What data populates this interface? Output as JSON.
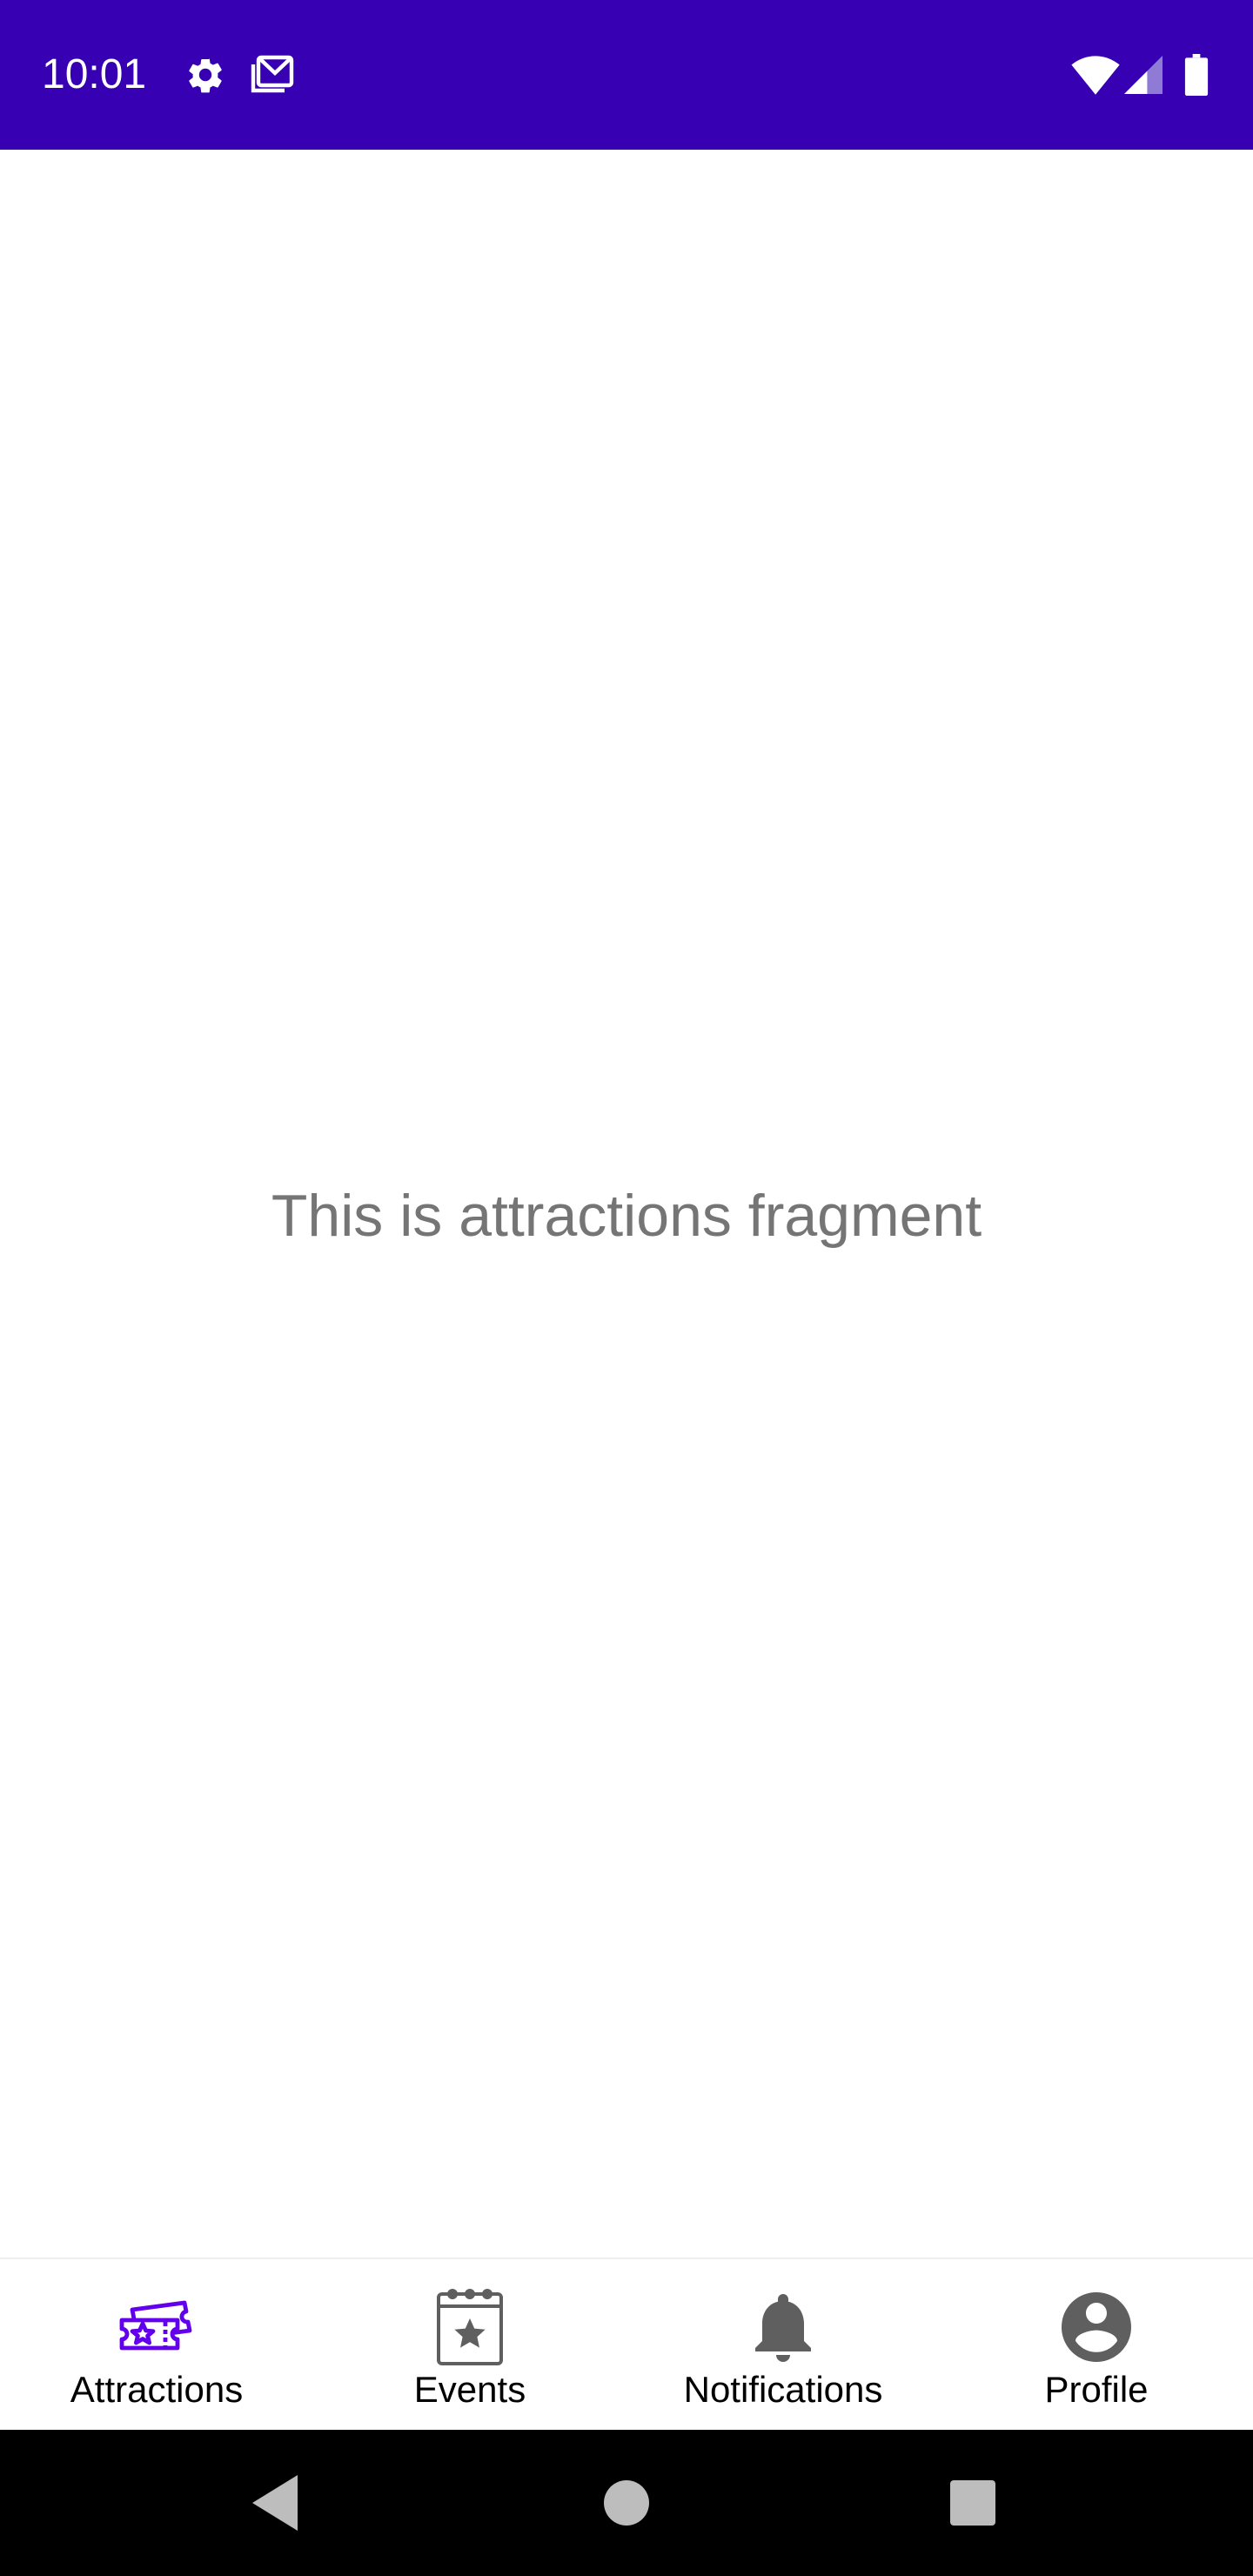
{
  "status_bar": {
    "time": "10:01",
    "background": "#3700b3",
    "icons": [
      "gear-icon",
      "gmail-icon",
      "wifi-icon",
      "cell-signal-icon",
      "battery-icon"
    ]
  },
  "content": {
    "message": "This is attractions fragment",
    "text_color": "#757575"
  },
  "bottom_nav": {
    "active_color": "#6200ee",
    "inactive_icon_color": "#5f5f5f",
    "items": [
      {
        "label": "Attractions",
        "icon": "ticket-icon",
        "active": true
      },
      {
        "label": "Events",
        "icon": "calendar-star-icon",
        "active": false
      },
      {
        "label": "Notifications",
        "icon": "bell-icon",
        "active": false
      },
      {
        "label": "Profile",
        "icon": "account-circle-icon",
        "active": false
      }
    ]
  },
  "system_nav": {
    "buttons": [
      "back-icon",
      "home-icon",
      "recents-icon"
    ]
  }
}
